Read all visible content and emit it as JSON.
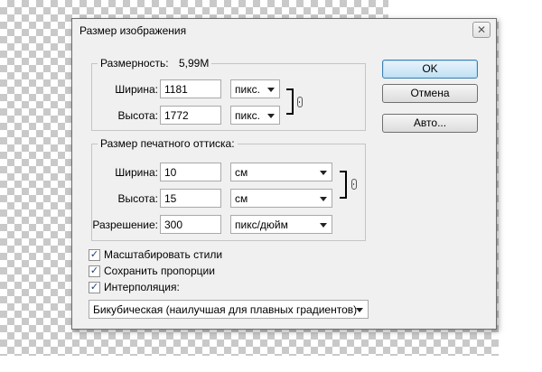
{
  "dialog": {
    "title": "Размер изображения",
    "close_glyph": "✕"
  },
  "pixel_dimensions": {
    "legend_label": "Размерность:",
    "legend_value": "5,99M",
    "width_label": "Ширина:",
    "width_value": "1181",
    "width_unit": "пикс.",
    "height_label": "Высота:",
    "height_value": "1772",
    "height_unit": "пикс."
  },
  "document_size": {
    "legend": "Размер печатного оттиска:",
    "width_label": "Ширина:",
    "width_value": "10",
    "width_unit": "см",
    "height_label": "Высота:",
    "height_value": "15",
    "height_unit": "см",
    "resolution_label": "Разрешение:",
    "resolution_value": "300",
    "resolution_unit": "пикс/дюйм"
  },
  "buttons": {
    "ok": "OK",
    "cancel": "Отмена",
    "auto": "Авто..."
  },
  "options": {
    "scale_styles": {
      "label": "Масштабировать стили",
      "checked": true
    },
    "constrain_proportions": {
      "label": "Сохранить пропорции",
      "checked": true
    },
    "resample": {
      "label": "Интерполяция:",
      "checked": true
    },
    "resample_method": "Бикубическая (наилучшая для плавных градиентов)"
  },
  "icons": {
    "link": "chain-link-icon",
    "close": "close-icon",
    "dropdown": "chevron-down-icon"
  }
}
